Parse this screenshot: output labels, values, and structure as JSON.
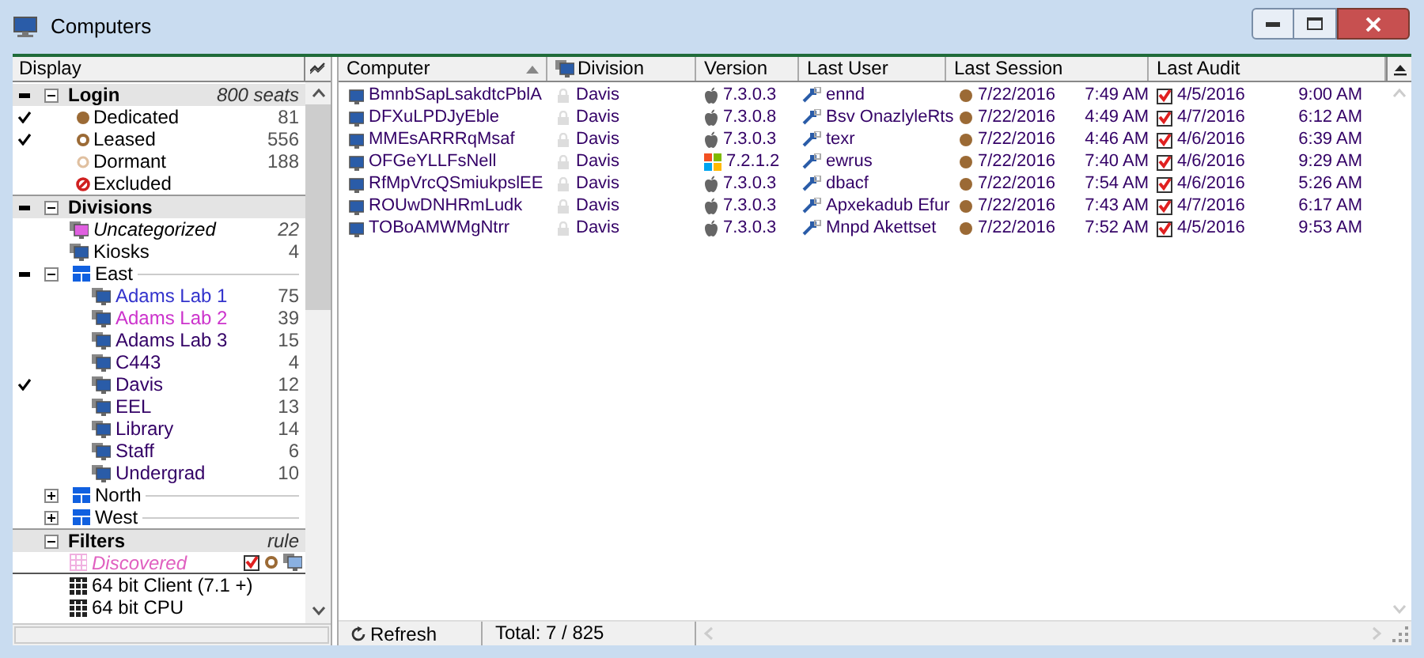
{
  "window": {
    "title": "Computers"
  },
  "sidebar": {
    "header": "Display",
    "sections": [
      {
        "title": "Login",
        "note": "800 seats",
        "expanded": true,
        "partial": true,
        "items": [
          {
            "label": "Dedicated",
            "count": "81",
            "checked": true,
            "kind": "dedicated"
          },
          {
            "label": "Leased",
            "count": "556",
            "checked": true,
            "kind": "leased"
          },
          {
            "label": "Dormant",
            "count": "188",
            "checked": false,
            "kind": "dormant"
          },
          {
            "label": "Excluded",
            "checked": false,
            "kind": "excluded"
          }
        ]
      },
      {
        "title": "Divisions",
        "expanded": true,
        "partial": true,
        "items": [
          {
            "label": "Uncategorized",
            "count": "22",
            "checked": false,
            "kind": "uncategorized"
          },
          {
            "label": "Kiosks",
            "count": "4",
            "checked": false,
            "kind": "lab"
          },
          {
            "label": "East",
            "kind": "region",
            "expanded": true,
            "partial": true,
            "children": [
              {
                "label": "Adams Lab 1",
                "count": "75",
                "checked": false,
                "kind": "lab",
                "color": "#3333cc"
              },
              {
                "label": "Adams Lab 2",
                "count": "39",
                "checked": false,
                "kind": "lab",
                "color": "#cc33cc"
              },
              {
                "label": "Adams Lab 3",
                "count": "15",
                "checked": false,
                "kind": "lab",
                "color": "#330066"
              },
              {
                "label": "C443",
                "count": "4",
                "checked": false,
                "kind": "lab",
                "color": "#330066"
              },
              {
                "label": "Davis",
                "count": "12",
                "checked": true,
                "kind": "lab",
                "color": "#330066"
              },
              {
                "label": "EEL",
                "count": "13",
                "checked": false,
                "kind": "lab",
                "color": "#330066"
              },
              {
                "label": "Library",
                "count": "14",
                "checked": false,
                "kind": "lab",
                "color": "#330066"
              },
              {
                "label": "Staff",
                "count": "6",
                "checked": false,
                "kind": "lab",
                "color": "#330066"
              },
              {
                "label": "Undergrad",
                "count": "10",
                "checked": false,
                "kind": "lab",
                "color": "#330066"
              }
            ]
          },
          {
            "label": "North",
            "kind": "region",
            "expanded": false,
            "partial": false
          },
          {
            "label": "West",
            "kind": "region",
            "expanded": false,
            "partial": false
          }
        ]
      },
      {
        "title": "Filters",
        "note": "rule",
        "expanded": true,
        "partial": false,
        "items": [
          {
            "label": "Discovered",
            "kind": "discovered"
          },
          {
            "label": "64 bit Client (7.1 +)",
            "kind": "filter"
          },
          {
            "label": "64 bit CPU",
            "kind": "filter"
          }
        ]
      }
    ]
  },
  "table": {
    "columns": [
      {
        "label": "Computer",
        "kind": "text",
        "sorted": true
      },
      {
        "label": "Division",
        "kind": "division",
        "sorted": false
      },
      {
        "label": "Version",
        "kind": "text",
        "sorted": false
      },
      {
        "label": "Last User",
        "kind": "text",
        "sorted": false
      },
      {
        "label": "Last Session",
        "kind": "text",
        "sorted": false
      },
      {
        "label": "Last Audit",
        "kind": "text",
        "sorted": false
      }
    ],
    "rows": [
      {
        "computer": "BmnbSapLsakdtcPblA",
        "division": "Davis",
        "kind": "apple",
        "version": "7.3.0.3",
        "user": "ennd",
        "session_date": "7/22/2016",
        "session_time": "7:49 AM",
        "audit_date": "4/5/2016",
        "audit_time": "9:00 AM"
      },
      {
        "computer": "DFXuLPDJyEble",
        "division": "Davis",
        "kind": "apple",
        "version": "7.3.0.8",
        "user": "Bsv OnazlyleRts",
        "session_date": "7/22/2016",
        "session_time": "4:49 AM",
        "audit_date": "4/7/2016",
        "audit_time": "6:12 AM"
      },
      {
        "computer": "MMEsARRRqMsaf",
        "division": "Davis",
        "kind": "apple",
        "version": "7.3.0.3",
        "user": "texr",
        "session_date": "7/22/2016",
        "session_time": "4:46 AM",
        "audit_date": "4/6/2016",
        "audit_time": "6:39 AM"
      },
      {
        "computer": "OFGeYLLFsNell",
        "division": "Davis",
        "kind": "windows",
        "version": "7.2.1.2",
        "user": "ewrus",
        "session_date": "7/22/2016",
        "session_time": "7:40 AM",
        "audit_date": "4/6/2016",
        "audit_time": "9:29 AM"
      },
      {
        "computer": "RfMpVrcQSmiukpslEE",
        "division": "Davis",
        "kind": "apple",
        "version": "7.3.0.3",
        "user": "dbacf",
        "session_date": "7/22/2016",
        "session_time": "7:54 AM",
        "audit_date": "4/6/2016",
        "audit_time": "5:26 AM"
      },
      {
        "computer": "ROUwDNHRmLudk",
        "division": "Davis",
        "kind": "apple",
        "version": "7.3.0.3",
        "user": "Apxekadub Efur",
        "session_date": "7/22/2016",
        "session_time": "7:43 AM",
        "audit_date": "4/7/2016",
        "audit_time": "6:17 AM"
      },
      {
        "computer": "TOBoAMWMgNtrr",
        "division": "Davis",
        "kind": "apple",
        "version": "7.3.0.3",
        "user": "Mnpd Akettset",
        "session_date": "7/22/2016",
        "session_time": "7:52 AM",
        "audit_date": "4/5/2016",
        "audit_time": "9:53 AM"
      }
    ]
  },
  "status_bar": {
    "refresh": "Refresh",
    "total": "Total: 7 / 825"
  }
}
